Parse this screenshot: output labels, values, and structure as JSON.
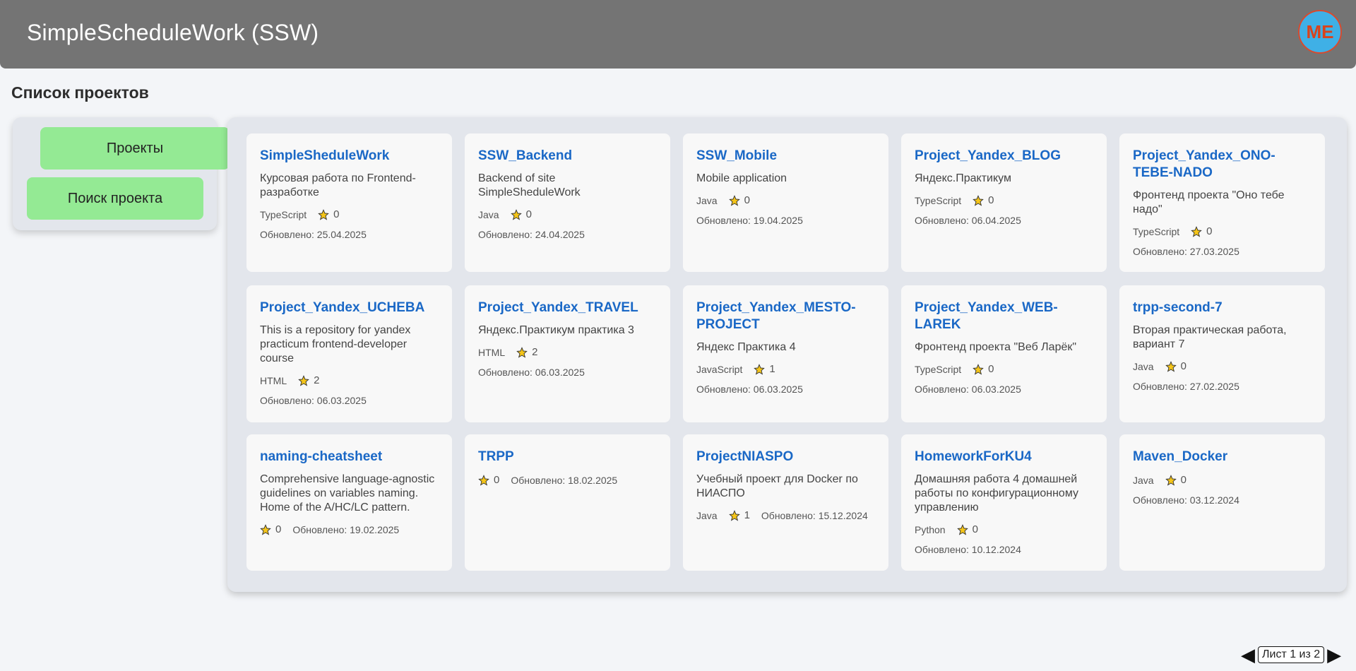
{
  "app": {
    "title": "SimpleScheduleWork (SSW)",
    "avatar_initials": "ME"
  },
  "page": {
    "heading": "Список проектов"
  },
  "menu": {
    "projects_label": "Проекты",
    "search_label": "Поиск проекта"
  },
  "date_prefix": "Обновлено: ",
  "projects": [
    {
      "name": "SimpleSheduleWork",
      "description": "Курсовая работа по Frontend-разработке",
      "language": "TypeScript",
      "stars": "0",
      "updated": "25.04.2025"
    },
    {
      "name": "SSW_Backend",
      "description": "Backend of site SimpleSheduleWork",
      "language": "Java",
      "stars": "0",
      "updated": "24.04.2025"
    },
    {
      "name": "SSW_Mobile",
      "description": "Mobile application",
      "language": "Java",
      "stars": "0",
      "updated": "19.04.2025"
    },
    {
      "name": "Project_Yandex_BLOG",
      "description": "Яндекс.Практикум",
      "language": "TypeScript",
      "stars": "0",
      "updated": "06.04.2025"
    },
    {
      "name": "Project_Yandex_ONO-TEBE-NADO",
      "description": "Фронтенд проекта \"Оно тебе надо\"",
      "language": "TypeScript",
      "stars": "0",
      "updated": "27.03.2025"
    },
    {
      "name": "Project_Yandex_UCHEBA",
      "description": "This is a repository for yandex practicum frontend-developer course",
      "language": "HTML",
      "stars": "2",
      "updated": "06.03.2025"
    },
    {
      "name": "Project_Yandex_TRAVEL",
      "description": "Яндекс.Практикум практика 3",
      "language": "HTML",
      "stars": "2",
      "updated": "06.03.2025"
    },
    {
      "name": "Project_Yandex_MESTO-PROJECT",
      "description": "Яндекс Практика 4",
      "language": "JavaScript",
      "stars": "1",
      "updated": "06.03.2025"
    },
    {
      "name": "Project_Yandex_WEB-LAREK",
      "description": "Фронтенд проекта \"Веб Ларёк\"",
      "language": "TypeScript",
      "stars": "0",
      "updated": "06.03.2025"
    },
    {
      "name": "trpp-second-7",
      "description": "Вторая практическая работа, вариант 7",
      "language": "Java",
      "stars": "0",
      "updated": "27.02.2025"
    },
    {
      "name": "naming-cheatsheet",
      "description": "Comprehensive language-agnostic guidelines on variables naming. Home of the A/HC/LC pattern.",
      "language": "",
      "stars": "0",
      "updated": "19.02.2025"
    },
    {
      "name": "TRPP",
      "description": "",
      "language": "",
      "stars": "0",
      "updated": "18.02.2025"
    },
    {
      "name": "ProjectNIASPO",
      "description": "Учебный проект для Docker по НИАСПО",
      "language": "Java",
      "stars": "1",
      "updated": "15.12.2024"
    },
    {
      "name": "HomeworkForKU4",
      "description": "Домашняя работа 4 домашней работы по конфигурационному управлению",
      "language": "Python",
      "stars": "0",
      "updated": "10.12.2024"
    },
    {
      "name": "Maven_Docker",
      "description": "",
      "language": "Java",
      "stars": "0",
      "updated": "03.12.2024"
    }
  ],
  "pagination": {
    "label": "Лист 1 из 2",
    "prev_icon": "triangle-left",
    "next_icon": "triangle-right"
  },
  "colors": {
    "header": "#747474",
    "menu_button": "#94ea94",
    "link": "#1a68c6",
    "star": "#f5c518"
  }
}
